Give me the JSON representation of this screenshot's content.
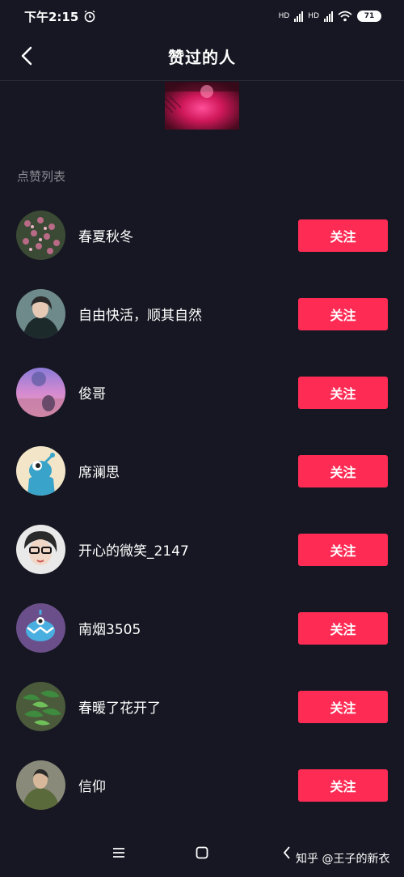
{
  "status_bar": {
    "time": "下午2:15",
    "network1": "HD",
    "network2": "HD",
    "battery": "71"
  },
  "header": {
    "title": "赞过的人"
  },
  "section": {
    "label": "点赞列表"
  },
  "users": [
    {
      "name": "春夏秋冬",
      "follow_label": "关注"
    },
    {
      "name": "自由快活，顺其自然",
      "follow_label": "关注"
    },
    {
      "name": "俊哥",
      "follow_label": "关注"
    },
    {
      "name": "席澜思",
      "follow_label": "关注"
    },
    {
      "name": "开心的微笑_2147",
      "follow_label": "关注"
    },
    {
      "name": "南烟3505",
      "follow_label": "关注"
    },
    {
      "name": "春暖了花开了",
      "follow_label": "关注"
    },
    {
      "name": "信仰",
      "follow_label": "关注"
    }
  ],
  "watermark": "知乎 @王子的新衣",
  "colors": {
    "background": "#161722",
    "accent": "#fe2c55",
    "secondary_text": "#8a8b93"
  }
}
